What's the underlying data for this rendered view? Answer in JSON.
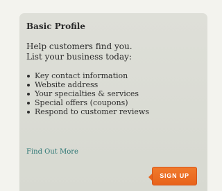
{
  "card": {
    "title": "Basic Profile",
    "intro_line1": "Help customers find you.",
    "intro_line2": "List your business today:",
    "features": [
      "Key contact information",
      "Website address",
      "Your specialties & services",
      "Special offers (coupons)",
      "Respond to customer reviews"
    ],
    "find_more_label": "Find Out More",
    "signup_label": "SIGN UP"
  },
  "colors": {
    "card_background": "#dcddd5",
    "link": "#2d7775",
    "signup_button": "#ec6e22"
  }
}
